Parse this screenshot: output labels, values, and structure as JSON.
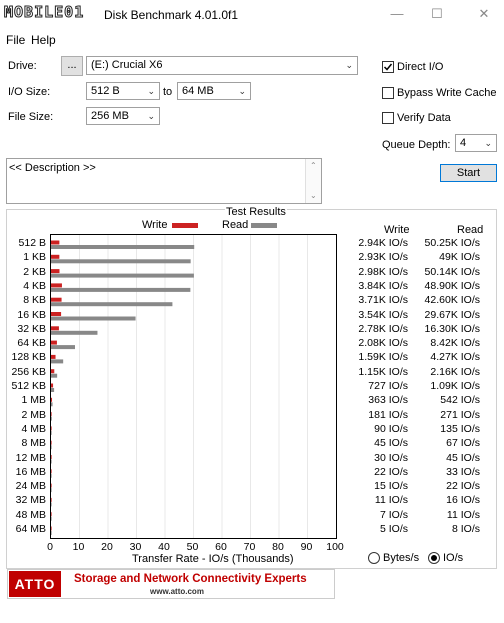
{
  "window": {
    "title_logo": "MOBILE01",
    "title": "Disk Benchmark 4.01.0f1"
  },
  "menu": {
    "file": "File",
    "help": "Help"
  },
  "drive": {
    "label": "Drive:",
    "browse_label": "...",
    "value": "(E:) Crucial X6"
  },
  "io_size": {
    "label": "I/O Size:",
    "from": "512 B",
    "to_label": "to",
    "to": "64 MB"
  },
  "file_size": {
    "label": "File Size:",
    "value": "256 MB"
  },
  "options": {
    "direct_io": {
      "label": "Direct I/O",
      "checked": true
    },
    "bypass_write_cache": {
      "label": "Bypass Write Cache",
      "checked": false
    },
    "verify_data": {
      "label": "Verify Data",
      "checked": false
    },
    "queue_depth": {
      "label": "Queue Depth:",
      "value": "4"
    }
  },
  "start_label": "Start",
  "description": "<< Description >>",
  "results": {
    "title": "Test Results",
    "legend_write": "Write",
    "legend_read": "Read",
    "write_header": "Write",
    "read_header": "Read",
    "write_color": "#cc2222",
    "read_color": "#888888"
  },
  "units": {
    "bytes_label": "Bytes/s",
    "io_label": "IO/s",
    "selected": "IO/s"
  },
  "footer": {
    "logo": "ATTO",
    "tagline": "Storage and Network Connectivity Experts",
    "url": "www.atto.com"
  },
  "chart_data": {
    "type": "bar",
    "orientation": "horizontal",
    "title": "Test Results",
    "xlabel": "Transfer Rate - IO/s (Thousands)",
    "xlim": [
      0,
      100
    ],
    "x_ticks": [
      "0",
      "10",
      "20",
      "30",
      "40",
      "50",
      "60",
      "70",
      "80",
      "90",
      "100"
    ],
    "categories": [
      "512 B",
      "1 KB",
      "2 KB",
      "4 KB",
      "8 KB",
      "16 KB",
      "32 KB",
      "64 KB",
      "128 KB",
      "256 KB",
      "512 KB",
      "1 MB",
      "2 MB",
      "4 MB",
      "8 MB",
      "12 MB",
      "16 MB",
      "24 MB",
      "32 MB",
      "48 MB",
      "64 MB"
    ],
    "series": [
      {
        "name": "Write",
        "values": [
          2.94,
          2.93,
          2.98,
          3.84,
          3.71,
          3.54,
          2.78,
          2.08,
          1.59,
          1.15,
          0.727,
          0.363,
          0.181,
          0.09,
          0.045,
          0.03,
          0.022,
          0.015,
          0.011,
          0.007,
          0.005
        ]
      },
      {
        "name": "Read",
        "values": [
          50.25,
          49,
          50.14,
          48.9,
          42.6,
          29.67,
          16.3,
          8.42,
          4.27,
          2.16,
          1.09,
          0.542,
          0.271,
          0.135,
          0.067,
          0.045,
          0.033,
          0.022,
          0.016,
          0.011,
          0.008
        ]
      }
    ],
    "write_labels": [
      "2.94K IO/s",
      "2.93K IO/s",
      "2.98K IO/s",
      "3.84K IO/s",
      "3.71K IO/s",
      "3.54K IO/s",
      "2.78K IO/s",
      "2.08K IO/s",
      "1.59K IO/s",
      "1.15K IO/s",
      "727 IO/s",
      "363 IO/s",
      "181 IO/s",
      "90 IO/s",
      "45 IO/s",
      "30 IO/s",
      "22 IO/s",
      "15 IO/s",
      "11 IO/s",
      "7 IO/s",
      "5 IO/s"
    ],
    "read_labels": [
      "50.25K IO/s",
      "49K IO/s",
      "50.14K IO/s",
      "48.90K IO/s",
      "42.60K IO/s",
      "29.67K IO/s",
      "16.30K IO/s",
      "8.42K IO/s",
      "4.27K IO/s",
      "2.16K IO/s",
      "1.09K IO/s",
      "542 IO/s",
      "271 IO/s",
      "135 IO/s",
      "67 IO/s",
      "45 IO/s",
      "33 IO/s",
      "22 IO/s",
      "16 IO/s",
      "11 IO/s",
      "8 IO/s"
    ]
  }
}
